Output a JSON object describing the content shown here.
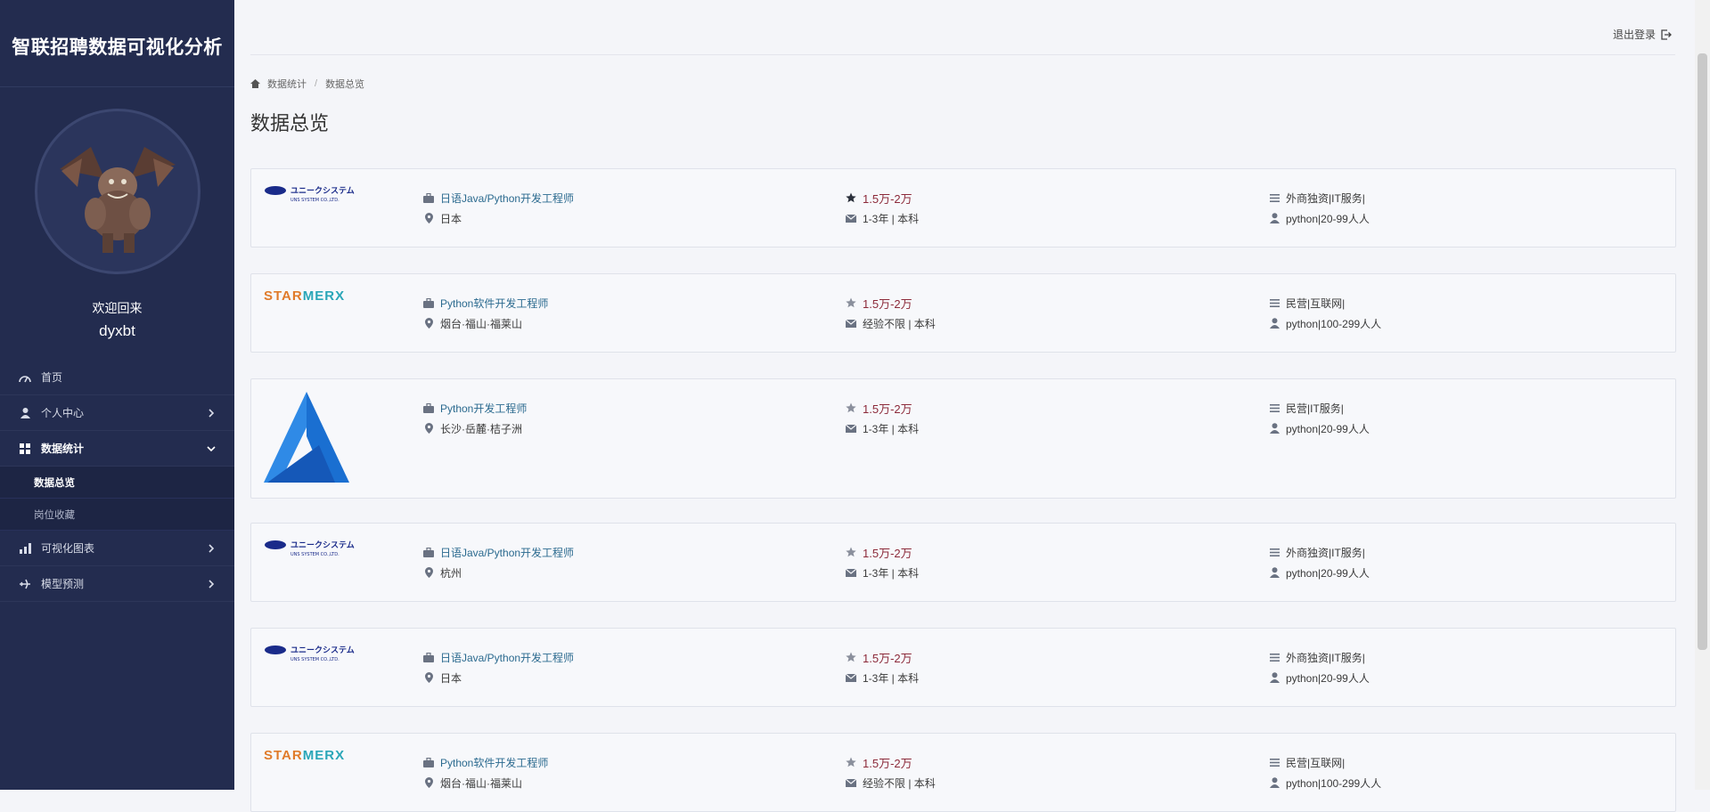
{
  "app": {
    "title": "智联招聘数据可视化分析"
  },
  "user": {
    "welcome": "欢迎回来",
    "name": "dyxbt"
  },
  "nav": {
    "home": "首页",
    "personal": "个人中心",
    "stats": "数据统计",
    "stats_sub": [
      "数据总览",
      "岗位收藏"
    ],
    "charts": "可视化图表",
    "model": "模型预测"
  },
  "header": {
    "logout": "退出登录"
  },
  "breadcrumb": {
    "parent": "数据统计",
    "current": "数据总览"
  },
  "page": {
    "title": "数据总览"
  },
  "jobs": [
    {
      "logo": "uns",
      "title": "日语Java/Python开发工程师",
      "location": "日本",
      "salary": "1.5万-2万",
      "exp": "1-3年 | 本科",
      "company_type": "外商独资|IT服务|",
      "size": "python|20-99人人"
    },
    {
      "logo": "starmerx",
      "title": "Python软件开发工程师",
      "location": "烟台·福山·福莱山",
      "salary": "1.5万-2万",
      "exp": "经验不限 | 本科",
      "company_type": "民营|互联网|",
      "size": "python|100-299人人"
    },
    {
      "logo": "blue",
      "title": "Python开发工程师",
      "location": "长沙·岳麓·桔子洲",
      "salary": "1.5万-2万",
      "exp": "1-3年 | 本科",
      "company_type": "民营|IT服务|",
      "size": "python|20-99人人"
    },
    {
      "logo": "uns",
      "title": "日语Java/Python开发工程师",
      "location": "杭州",
      "salary": "1.5万-2万",
      "exp": "1-3年 | 本科",
      "company_type": "外商独资|IT服务|",
      "size": "python|20-99人人"
    },
    {
      "logo": "uns",
      "title": "日语Java/Python开发工程师",
      "location": "日本",
      "salary": "1.5万-2万",
      "exp": "1-3年 | 本科",
      "company_type": "外商独资|IT服务|",
      "size": "python|20-99人人"
    },
    {
      "logo": "starmerx",
      "title": "Python软件开发工程师",
      "location": "烟台·福山·福莱山",
      "salary": "1.5万-2万",
      "exp": "经验不限 | 本科",
      "company_type": "民营|互联网|",
      "size": "python|100-299人人"
    }
  ],
  "logos": {
    "uns_text": "ユニークシステム",
    "uns_sub": "UNS SYSTEM CO.,LTD.",
    "starmerx": "STARMERX"
  },
  "colors": {
    "sidebar": "#232c4f",
    "job_title": "#2b6a8f",
    "salary": "#8c2a3a",
    "starmerx_orange": "#e07b2a",
    "starmerx_teal": "#2aa6b8",
    "logo_blue": "#1a6fd1"
  }
}
